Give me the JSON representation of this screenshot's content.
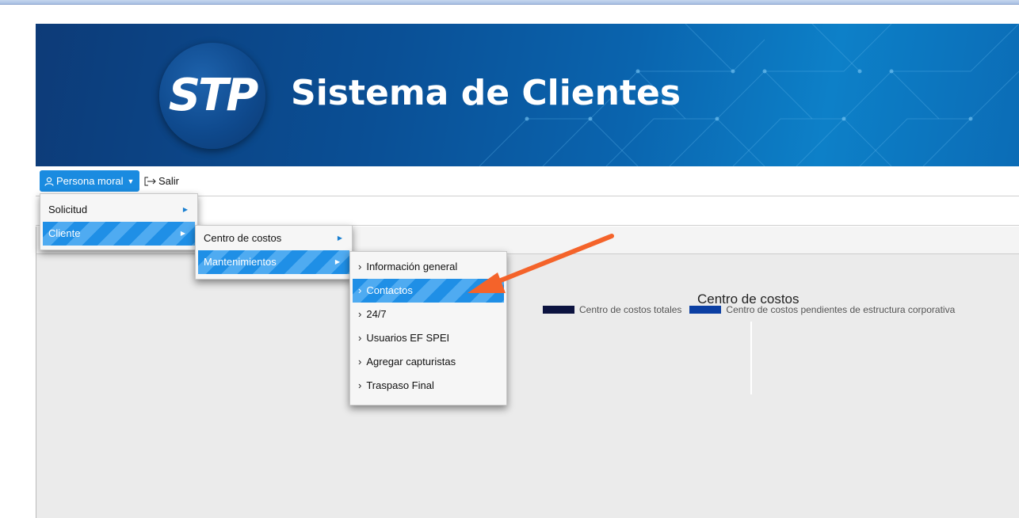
{
  "header": {
    "logo_text": "STP",
    "app_title": "Sistema de Clientes"
  },
  "navbar": {
    "persona_label": "Persona moral",
    "salir_label": "Salir"
  },
  "menus": {
    "level1": [
      {
        "label": "Solicitud"
      },
      {
        "label": "Cliente"
      }
    ],
    "level2": [
      {
        "label": "Centro de costos"
      },
      {
        "label": "Mantenimientos"
      }
    ],
    "level3": [
      {
        "label": "Información general"
      },
      {
        "label": "Contactos"
      },
      {
        "label": "24/7"
      },
      {
        "label": "Usuarios EF SPEI"
      },
      {
        "label": "Agregar capturistas"
      },
      {
        "label": "Traspaso Final"
      }
    ]
  },
  "chart": {
    "title": "Centro de costos",
    "legend": [
      {
        "label": "Centro de costos totales",
        "color": "#0c1340"
      },
      {
        "label": "Centro de costos pendientes de estructura corporativa",
        "color": "#0b3fa3"
      }
    ]
  },
  "colors": {
    "accent": "#1a8be0",
    "annotation_arrow": "#f4632a"
  }
}
